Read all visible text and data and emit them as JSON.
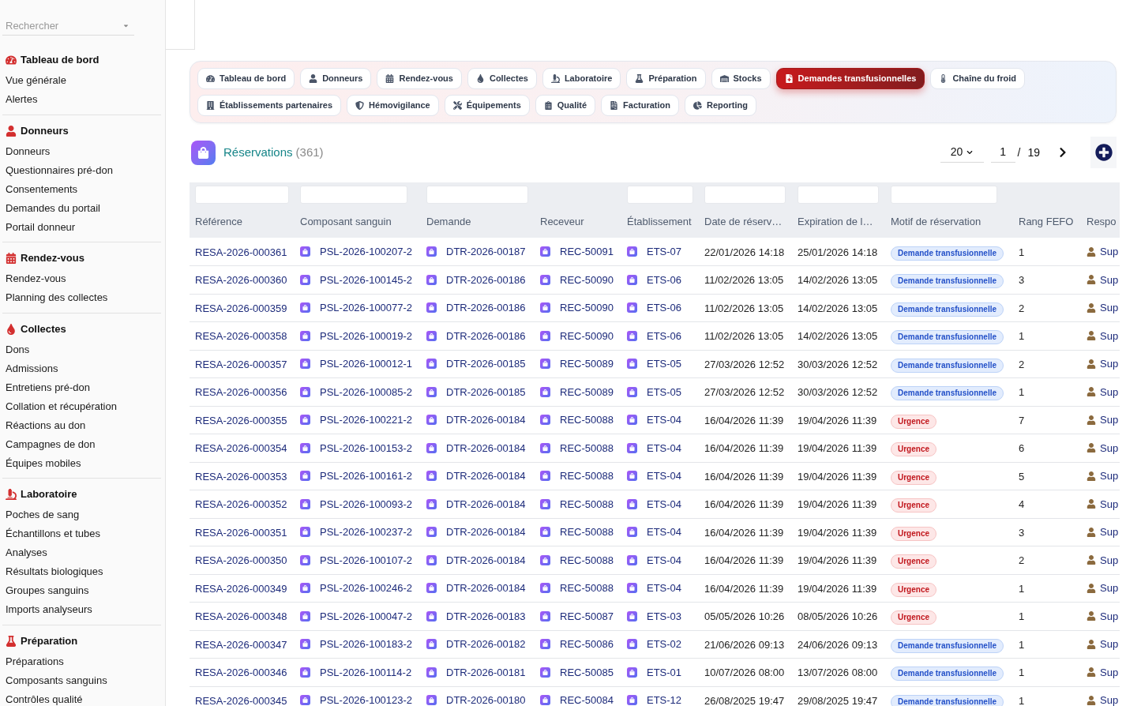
{
  "sidebar": {
    "search": {
      "placeholder": "Rechercher"
    },
    "sections": [
      {
        "title": "Tableau de bord",
        "items": [
          "Vue générale",
          "Alertes"
        ]
      },
      {
        "title": "Donneurs",
        "items": [
          "Donneurs",
          "Questionnaires pré-don",
          "Consentements",
          "Demandes du portail",
          "Portail donneur"
        ]
      },
      {
        "title": "Rendez-vous",
        "items": [
          "Rendez-vous",
          "Planning des collectes"
        ]
      },
      {
        "title": "Collectes",
        "items": [
          "Dons",
          "Admissions",
          "Entretiens pré-don",
          "Collation et récupération",
          "Réactions au don",
          "Campagnes de don",
          "Équipes mobiles"
        ]
      },
      {
        "title": "Laboratoire",
        "items": [
          "Poches de sang",
          "Échantillons et tubes",
          "Analyses",
          "Résultats biologiques",
          "Groupes sanguins",
          "Imports analyseurs"
        ]
      },
      {
        "title": "Préparation",
        "items": [
          "Préparations",
          "Composants sanguins",
          "Contrôles qualité"
        ]
      }
    ]
  },
  "nav_tabs": [
    {
      "label": "Tableau de bord",
      "selected": false
    },
    {
      "label": "Donneurs",
      "selected": false
    },
    {
      "label": "Rendez-vous",
      "selected": false
    },
    {
      "label": "Collectes",
      "selected": false
    },
    {
      "label": "Laboratoire",
      "selected": false
    },
    {
      "label": "Préparation",
      "selected": false
    },
    {
      "label": "Stocks",
      "selected": false
    },
    {
      "label": "Demandes transfusionnelles",
      "selected": true
    },
    {
      "label": "Chaîne du froid",
      "selected": false
    },
    {
      "label": "Établissements partenaires",
      "selected": false
    },
    {
      "label": "Hémovigilance",
      "selected": false
    },
    {
      "label": "Équipements",
      "selected": false
    },
    {
      "label": "Qualité",
      "selected": false
    },
    {
      "label": "Facturation",
      "selected": false
    },
    {
      "label": "Reporting",
      "selected": false
    }
  ],
  "list": {
    "title": "Réservations",
    "count": "(361)",
    "pagination": {
      "page_size": "20",
      "page": "1",
      "separator": "/",
      "page_count": "19"
    }
  },
  "table": {
    "columns": [
      {
        "label": "Référence",
        "filter": true
      },
      {
        "label": "Composant sanguin",
        "filter": true
      },
      {
        "label": "Demande",
        "filter": true
      },
      {
        "label": "Receveur",
        "filter": false
      },
      {
        "label": "Établissement",
        "filter": true
      },
      {
        "label": "Date de réserv…",
        "filter": true
      },
      {
        "label": "Expiration de l…",
        "filter": true
      },
      {
        "label": "Motif de réservation",
        "filter": true
      },
      {
        "label": "Rang FEFO",
        "filter": false
      },
      {
        "label": "Respo",
        "filter": false
      }
    ],
    "rows": [
      {
        "reference": "RESA-2026-000361",
        "component": "PSL-2026-100207-2",
        "request": "DTR-2026-00187",
        "recipient": "REC-50091",
        "facility": "ETS-07",
        "reserved_at": "22/01/2026 14:18",
        "expires_at": "25/01/2026 14:18",
        "reason": {
          "label": "Demande transfusionnelle",
          "kind": "request"
        },
        "fefo_rank": "1",
        "owner": "Sup"
      },
      {
        "reference": "RESA-2026-000360",
        "component": "PSL-2026-100145-2",
        "request": "DTR-2026-00186",
        "recipient": "REC-50090",
        "facility": "ETS-06",
        "reserved_at": "11/02/2026 13:05",
        "expires_at": "14/02/2026 13:05",
        "reason": {
          "label": "Demande transfusionnelle",
          "kind": "request"
        },
        "fefo_rank": "3",
        "owner": "Sup"
      },
      {
        "reference": "RESA-2026-000359",
        "component": "PSL-2026-100077-2",
        "request": "DTR-2026-00186",
        "recipient": "REC-50090",
        "facility": "ETS-06",
        "reserved_at": "11/02/2026 13:05",
        "expires_at": "14/02/2026 13:05",
        "reason": {
          "label": "Demande transfusionnelle",
          "kind": "request"
        },
        "fefo_rank": "2",
        "owner": "Sup"
      },
      {
        "reference": "RESA-2026-000358",
        "component": "PSL-2026-100019-2",
        "request": "DTR-2026-00186",
        "recipient": "REC-50090",
        "facility": "ETS-06",
        "reserved_at": "11/02/2026 13:05",
        "expires_at": "14/02/2026 13:05",
        "reason": {
          "label": "Demande transfusionnelle",
          "kind": "request"
        },
        "fefo_rank": "1",
        "owner": "Sup"
      },
      {
        "reference": "RESA-2026-000357",
        "component": "PSL-2026-100012-1",
        "request": "DTR-2026-00185",
        "recipient": "REC-50089",
        "facility": "ETS-05",
        "reserved_at": "27/03/2026 12:52",
        "expires_at": "30/03/2026 12:52",
        "reason": {
          "label": "Demande transfusionnelle",
          "kind": "request"
        },
        "fefo_rank": "2",
        "owner": "Sup"
      },
      {
        "reference": "RESA-2026-000356",
        "component": "PSL-2026-100085-2",
        "request": "DTR-2026-00185",
        "recipient": "REC-50089",
        "facility": "ETS-05",
        "reserved_at": "27/03/2026 12:52",
        "expires_at": "30/03/2026 12:52",
        "reason": {
          "label": "Demande transfusionnelle",
          "kind": "request"
        },
        "fefo_rank": "1",
        "owner": "Sup"
      },
      {
        "reference": "RESA-2026-000355",
        "component": "PSL-2026-100221-2",
        "request": "DTR-2026-00184",
        "recipient": "REC-50088",
        "facility": "ETS-04",
        "reserved_at": "16/04/2026 11:39",
        "expires_at": "19/04/2026 11:39",
        "reason": {
          "label": "Urgence",
          "kind": "urgent"
        },
        "fefo_rank": "7",
        "owner": "Sup"
      },
      {
        "reference": "RESA-2026-000354",
        "component": "PSL-2026-100153-2",
        "request": "DTR-2026-00184",
        "recipient": "REC-50088",
        "facility": "ETS-04",
        "reserved_at": "16/04/2026 11:39",
        "expires_at": "19/04/2026 11:39",
        "reason": {
          "label": "Urgence",
          "kind": "urgent"
        },
        "fefo_rank": "6",
        "owner": "Sup"
      },
      {
        "reference": "RESA-2026-000353",
        "component": "PSL-2026-100161-2",
        "request": "DTR-2026-00184",
        "recipient": "REC-50088",
        "facility": "ETS-04",
        "reserved_at": "16/04/2026 11:39",
        "expires_at": "19/04/2026 11:39",
        "reason": {
          "label": "Urgence",
          "kind": "urgent"
        },
        "fefo_rank": "5",
        "owner": "Sup"
      },
      {
        "reference": "RESA-2026-000352",
        "component": "PSL-2026-100093-2",
        "request": "DTR-2026-00184",
        "recipient": "REC-50088",
        "facility": "ETS-04",
        "reserved_at": "16/04/2026 11:39",
        "expires_at": "19/04/2026 11:39",
        "reason": {
          "label": "Urgence",
          "kind": "urgent"
        },
        "fefo_rank": "4",
        "owner": "Sup"
      },
      {
        "reference": "RESA-2026-000351",
        "component": "PSL-2026-100237-2",
        "request": "DTR-2026-00184",
        "recipient": "REC-50088",
        "facility": "ETS-04",
        "reserved_at": "16/04/2026 11:39",
        "expires_at": "19/04/2026 11:39",
        "reason": {
          "label": "Urgence",
          "kind": "urgent"
        },
        "fefo_rank": "3",
        "owner": "Sup"
      },
      {
        "reference": "RESA-2026-000350",
        "component": "PSL-2026-100107-2",
        "request": "DTR-2026-00184",
        "recipient": "REC-50088",
        "facility": "ETS-04",
        "reserved_at": "16/04/2026 11:39",
        "expires_at": "19/04/2026 11:39",
        "reason": {
          "label": "Urgence",
          "kind": "urgent"
        },
        "fefo_rank": "2",
        "owner": "Sup"
      },
      {
        "reference": "RESA-2026-000349",
        "component": "PSL-2026-100246-2",
        "request": "DTR-2026-00184",
        "recipient": "REC-50088",
        "facility": "ETS-04",
        "reserved_at": "16/04/2026 11:39",
        "expires_at": "19/04/2026 11:39",
        "reason": {
          "label": "Urgence",
          "kind": "urgent"
        },
        "fefo_rank": "1",
        "owner": "Sup"
      },
      {
        "reference": "RESA-2026-000348",
        "component": "PSL-2026-100047-2",
        "request": "DTR-2026-00183",
        "recipient": "REC-50087",
        "facility": "ETS-03",
        "reserved_at": "05/05/2026 10:26",
        "expires_at": "08/05/2026 10:26",
        "reason": {
          "label": "Urgence",
          "kind": "urgent"
        },
        "fefo_rank": "1",
        "owner": "Sup"
      },
      {
        "reference": "RESA-2026-000347",
        "component": "PSL-2026-100183-2",
        "request": "DTR-2026-00182",
        "recipient": "REC-50086",
        "facility": "ETS-02",
        "reserved_at": "21/06/2026 09:13",
        "expires_at": "24/06/2026 09:13",
        "reason": {
          "label": "Demande transfusionnelle",
          "kind": "request"
        },
        "fefo_rank": "1",
        "owner": "Sup"
      },
      {
        "reference": "RESA-2026-000346",
        "component": "PSL-2026-100114-2",
        "request": "DTR-2026-00181",
        "recipient": "REC-50085",
        "facility": "ETS-01",
        "reserved_at": "10/07/2026 08:00",
        "expires_at": "13/07/2026 08:00",
        "reason": {
          "label": "Demande transfusionnelle",
          "kind": "request"
        },
        "fefo_rank": "1",
        "owner": "Sup"
      },
      {
        "reference": "RESA-2026-000345",
        "component": "PSL-2026-100123-2",
        "request": "DTR-2026-00180",
        "recipient": "REC-50084",
        "facility": "ETS-12",
        "reserved_at": "26/08/2025 19:47",
        "expires_at": "29/08/2025 19:47",
        "reason": {
          "label": "Demande transfusionnelle",
          "kind": "request"
        },
        "fefo_rank": "1",
        "owner": "Sup"
      }
    ]
  }
}
